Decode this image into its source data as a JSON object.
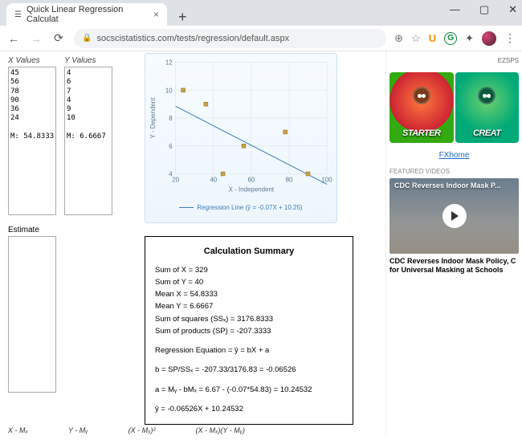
{
  "window": {
    "tab_title": "Quick Linear Regression Calculat",
    "url": "socscistatistics.com/tests/regression/default.aspx"
  },
  "inputs": {
    "x_header": "X Values",
    "y_header": "Y Values",
    "x_values": "45\n56\n78\n90\n36\n24\n\nM: 54.8333",
    "y_values": "4\n6\n7\n4\n9\n10\n\nM: 6.6667",
    "estimate_label": "Estimate",
    "estimate_value": ""
  },
  "chart_data": {
    "type": "scatter+line",
    "title": "",
    "xlabel": "X - Independent",
    "ylabel": "Y - Dependent",
    "xlim": [
      20,
      100
    ],
    "ylim": [
      4,
      12
    ],
    "xticks": [
      20,
      40,
      60,
      80,
      100
    ],
    "yticks": [
      4,
      6,
      8,
      10,
      12
    ],
    "points": [
      {
        "x": 24,
        "y": 10
      },
      {
        "x": 36,
        "y": 9
      },
      {
        "x": 45,
        "y": 4
      },
      {
        "x": 56,
        "y": 6
      },
      {
        "x": 78,
        "y": 7
      },
      {
        "x": 90,
        "y": 4
      }
    ],
    "regression": {
      "slope": -0.07,
      "intercept": 10.25
    },
    "legend_label": "Regression Line (ŷ = -0.07X + 10.25)"
  },
  "summary": {
    "heading": "Calculation Summary",
    "lines1": [
      "Sum of X = 329",
      "Sum of Y = 40",
      "Mean X = 54.8333",
      "Mean Y = 6.6667",
      "Sum of squares (SSₓ) = 3176.8333",
      "Sum of products (SP) = -207.3333"
    ],
    "eq_label": "Regression Equation = ŷ = bX + a",
    "b_line": "b = SP/SSₓ = -207.33/3176.83 = -0.06526",
    "a_line": "a = Mᵧ - bMₓ = 6.67 - (-0.07*54.83) = 10.24532",
    "yhat_line": "ŷ = -0.06526X + 10.24532"
  },
  "table_headers": {
    "c1": "X - Mₓ",
    "c2": "Y - Mᵧ",
    "c3": "(X - Mₓ)²",
    "c4": "(X - Mₓ)(Y - Mᵧ)"
  },
  "sidebar": {
    "top_right": "EZSPS",
    "mascot1": "STARTER",
    "mascot2": "CREAT",
    "link": "FXhome",
    "featured": "FEATURED VIDEOS",
    "video_overlay": "CDC Reverses Indoor Mask P...",
    "video_caption": "CDC Reverses Indoor Mask Policy, C for Universal Masking at Schools"
  }
}
